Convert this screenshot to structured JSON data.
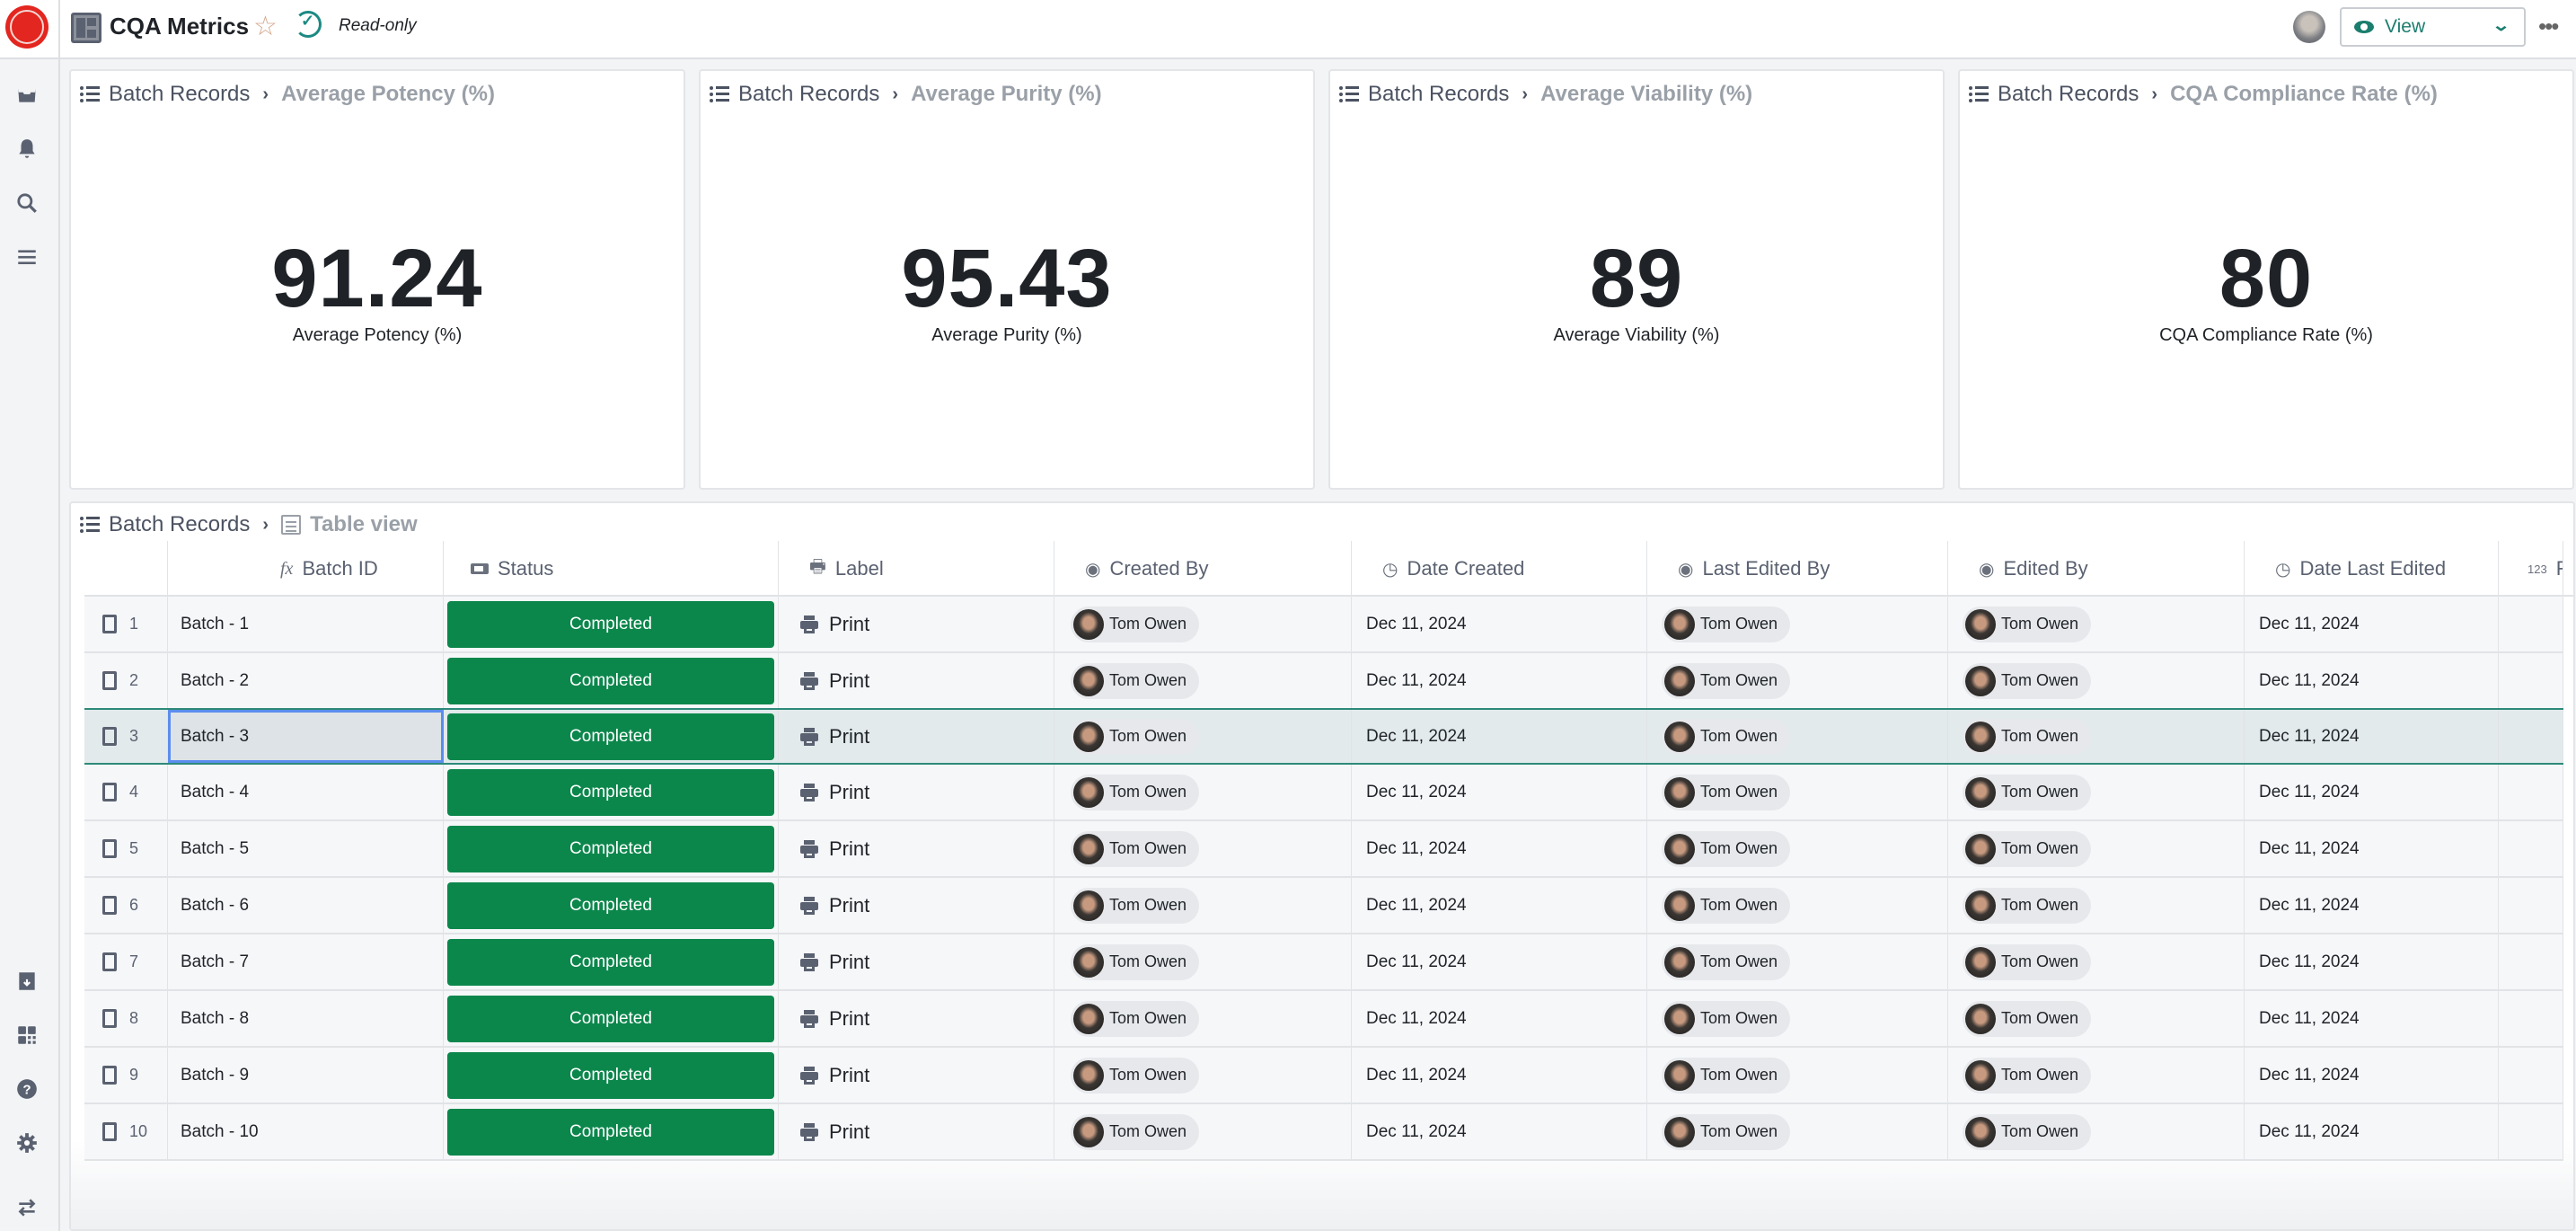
{
  "topbar": {
    "title": "CQA Metrics",
    "status": "Read-only",
    "view_button": "View",
    "icons": [
      "app-logo",
      "dashboard-icon",
      "star-icon",
      "sync-check-icon",
      "user-avatar",
      "eye-icon",
      "chevron-down-icon",
      "more-icon"
    ]
  },
  "sidebar": {
    "top_icons": [
      "inbox-icon",
      "bell-icon",
      "search-icon",
      "menu-icon"
    ],
    "bottom_icons": [
      "archive-icon",
      "apps-icon",
      "help-icon",
      "gear-icon",
      "swap-icon"
    ]
  },
  "cards": [
    {
      "root": "Batch Records",
      "leaf": "Average Potency (%)",
      "value": "91.24",
      "label": "Average Potency (%)"
    },
    {
      "root": "Batch Records",
      "leaf": "Average Purity (%)",
      "value": "95.43",
      "label": "Average Purity (%)"
    },
    {
      "root": "Batch Records",
      "leaf": "Average Viability (%)",
      "value": "89",
      "label": "Average Viability (%)"
    },
    {
      "root": "Batch Records",
      "leaf": "CQA Compliance Rate (%)",
      "value": "80",
      "label": "CQA Compliance Rate (%)"
    }
  ],
  "table": {
    "root": "Batch Records",
    "view": "Table view",
    "columns": [
      {
        "label": "",
        "icon": ""
      },
      {
        "label": "Batch ID",
        "icon": "fx"
      },
      {
        "label": "Status",
        "icon": "status-icon"
      },
      {
        "label": "Label",
        "icon": "print-icon"
      },
      {
        "label": "Created By",
        "icon": "user-icon"
      },
      {
        "label": "Date Created",
        "icon": "clock-icon"
      },
      {
        "label": "Last Edited By",
        "icon": "user-icon"
      },
      {
        "label": "Edited By",
        "icon": "user-icon"
      },
      {
        "label": "Date Last Edited",
        "icon": "clock-icon"
      },
      {
        "label": "F",
        "icon": "123"
      }
    ],
    "selected_row": 3,
    "rows": [
      {
        "num": "1",
        "batch_id": "Batch - 1",
        "status": "Completed",
        "label": "Print",
        "created_by": "Tom Owen",
        "date_created": "Dec 11, 2024",
        "last_edited_by": "Tom Owen",
        "edited_by": "Tom Owen",
        "date_last_edited": "Dec 11, 2024"
      },
      {
        "num": "2",
        "batch_id": "Batch - 2",
        "status": "Completed",
        "label": "Print",
        "created_by": "Tom Owen",
        "date_created": "Dec 11, 2024",
        "last_edited_by": "Tom Owen",
        "edited_by": "Tom Owen",
        "date_last_edited": "Dec 11, 2024"
      },
      {
        "num": "3",
        "batch_id": "Batch - 3",
        "status": "Completed",
        "label": "Print",
        "created_by": "Tom Owen",
        "date_created": "Dec 11, 2024",
        "last_edited_by": "Tom Owen",
        "edited_by": "Tom Owen",
        "date_last_edited": "Dec 11, 2024"
      },
      {
        "num": "4",
        "batch_id": "Batch - 4",
        "status": "Completed",
        "label": "Print",
        "created_by": "Tom Owen",
        "date_created": "Dec 11, 2024",
        "last_edited_by": "Tom Owen",
        "edited_by": "Tom Owen",
        "date_last_edited": "Dec 11, 2024"
      },
      {
        "num": "5",
        "batch_id": "Batch - 5",
        "status": "Completed",
        "label": "Print",
        "created_by": "Tom Owen",
        "date_created": "Dec 11, 2024",
        "last_edited_by": "Tom Owen",
        "edited_by": "Tom Owen",
        "date_last_edited": "Dec 11, 2024"
      },
      {
        "num": "6",
        "batch_id": "Batch - 6",
        "status": "Completed",
        "label": "Print",
        "created_by": "Tom Owen",
        "date_created": "Dec 11, 2024",
        "last_edited_by": "Tom Owen",
        "edited_by": "Tom Owen",
        "date_last_edited": "Dec 11, 2024"
      },
      {
        "num": "7",
        "batch_id": "Batch - 7",
        "status": "Completed",
        "label": "Print",
        "created_by": "Tom Owen",
        "date_created": "Dec 11, 2024",
        "last_edited_by": "Tom Owen",
        "edited_by": "Tom Owen",
        "date_last_edited": "Dec 11, 2024"
      },
      {
        "num": "8",
        "batch_id": "Batch - 8",
        "status": "Completed",
        "label": "Print",
        "created_by": "Tom Owen",
        "date_created": "Dec 11, 2024",
        "last_edited_by": "Tom Owen",
        "edited_by": "Tom Owen",
        "date_last_edited": "Dec 11, 2024"
      },
      {
        "num": "9",
        "batch_id": "Batch - 9",
        "status": "Completed",
        "label": "Print",
        "created_by": "Tom Owen",
        "date_created": "Dec 11, 2024",
        "last_edited_by": "Tom Owen",
        "edited_by": "Tom Owen",
        "date_last_edited": "Dec 11, 2024"
      },
      {
        "num": "10",
        "batch_id": "Batch - 10",
        "status": "Completed",
        "label": "Print",
        "created_by": "Tom Owen",
        "date_created": "Dec 11, 2024",
        "last_edited_by": "Tom Owen",
        "edited_by": "Tom Owen",
        "date_last_edited": "Dec 11, 2024"
      }
    ]
  },
  "colors": {
    "status_completed": "#0c874c",
    "accent": "#1b7d6e",
    "selected_row_border": "#2d8a79",
    "focus_outline": "#5b8def",
    "logo": "#e3261f"
  }
}
